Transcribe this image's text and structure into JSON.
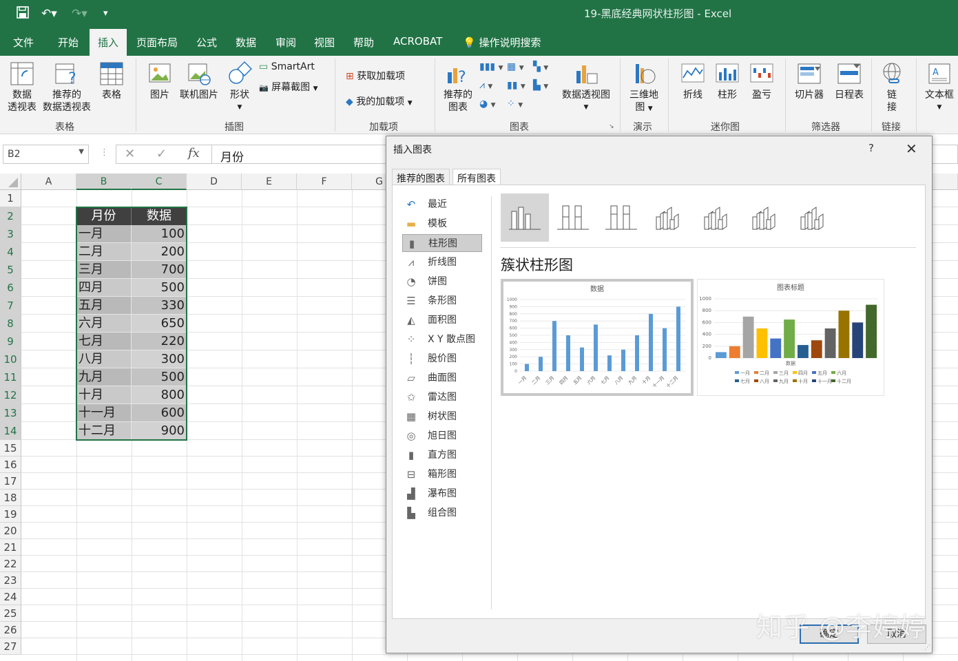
{
  "window": {
    "title": "19-黑底经典网状柱形图  -  Excel"
  },
  "menu": {
    "tabs": [
      "文件",
      "开始",
      "插入",
      "页面布局",
      "公式",
      "数据",
      "审阅",
      "视图",
      "帮助",
      "ACROBAT"
    ],
    "active": "插入",
    "tell_me": "操作说明搜索"
  },
  "ribbon": {
    "groups": {
      "tables": "表格",
      "illustrations": "插图",
      "addins": "加载项",
      "charts": "图表",
      "tours": "演示",
      "sparklines": "迷你图",
      "filters": "筛选器",
      "links": "链接"
    },
    "buttons": {
      "pivot_l1": "数据",
      "pivot_l2": "透视表",
      "rec_pivot_l1": "推荐的",
      "rec_pivot_l2": "数据透视表",
      "table": "表格",
      "picture": "图片",
      "online_picture": "联机图片",
      "shapes": "形状",
      "smartart": "SmartArt",
      "screenshot": "屏幕截图",
      "get_addins": "获取加载项",
      "my_addins": "我的加载项",
      "rec_charts_l1": "推荐的",
      "rec_charts_l2": "图表",
      "pivot_chart": "数据透视图",
      "map3d_l1": "三维地",
      "map3d_l2": "图",
      "line": "折线",
      "column": "柱形",
      "winloss": "盈亏",
      "slicer": "切片器",
      "timeline": "日程表",
      "link_l1": "链",
      "link_l2": "接",
      "textbox": "文本框"
    }
  },
  "formula_bar": {
    "name_box": "B2",
    "formula": "月份"
  },
  "sheet": {
    "columns": [
      "A",
      "B",
      "C",
      "D",
      "E",
      "F",
      "G"
    ],
    "rows": [
      "1",
      "2",
      "3",
      "4",
      "5",
      "6",
      "7",
      "8",
      "9",
      "10",
      "11",
      "12",
      "13",
      "14",
      "15",
      "16",
      "17",
      "18",
      "19",
      "20",
      "21",
      "22",
      "23",
      "24",
      "25",
      "26",
      "27"
    ],
    "table_headers": [
      "月份",
      "数据"
    ],
    "table_rows": [
      [
        "一月",
        "100"
      ],
      [
        "二月",
        "200"
      ],
      [
        "三月",
        "700"
      ],
      [
        "四月",
        "500"
      ],
      [
        "五月",
        "330"
      ],
      [
        "六月",
        "650"
      ],
      [
        "七月",
        "220"
      ],
      [
        "八月",
        "300"
      ],
      [
        "九月",
        "500"
      ],
      [
        "十月",
        "800"
      ],
      [
        "十一月",
        "600"
      ],
      [
        "十二月",
        "900"
      ]
    ]
  },
  "dialog": {
    "title": "插入图表",
    "help": "?",
    "tabs": [
      "推荐的图表",
      "所有图表"
    ],
    "active_tab": "所有图表",
    "chart_types": [
      "最近",
      "模板",
      "柱形图",
      "折线图",
      "饼图",
      "条形图",
      "面积图",
      "X Y 散点图",
      "股价图",
      "曲面图",
      "雷达图",
      "树状图",
      "旭日图",
      "直方图",
      "箱形图",
      "瀑布图",
      "组合图"
    ],
    "selected_type": "柱形图",
    "subtype_name": "簇状柱形图",
    "ok": "确定",
    "cancel": "取消"
  },
  "chart_data": [
    {
      "type": "bar",
      "title": "数据",
      "categories": [
        "一月",
        "二月",
        "三月",
        "四月",
        "五月",
        "六月",
        "七月",
        "八月",
        "九月",
        "十月",
        "十一月",
        "十二月"
      ],
      "values": [
        100,
        200,
        700,
        500,
        330,
        650,
        220,
        300,
        500,
        800,
        600,
        900
      ],
      "ylim": [
        0,
        1000
      ],
      "yticks": [
        0,
        100,
        200,
        300,
        400,
        500,
        600,
        700,
        800,
        900,
        1000
      ],
      "color": "#5b9bd5",
      "grid": true
    },
    {
      "type": "bar",
      "title": "图表标题",
      "xlabel": "数据",
      "categories": [
        "一月",
        "二月",
        "三月",
        "四月",
        "五月",
        "六月",
        "七月",
        "八月",
        "九月",
        "十月",
        "十一月",
        "十二月"
      ],
      "values": [
        100,
        200,
        700,
        500,
        330,
        650,
        220,
        300,
        500,
        800,
        600,
        900
      ],
      "ylim": [
        0,
        1000
      ],
      "yticks": [
        0,
        200,
        400,
        600,
        800,
        1000
      ],
      "colors": [
        "#5b9bd5",
        "#ed7d31",
        "#a5a5a5",
        "#ffc000",
        "#4472c4",
        "#70ad47",
        "#255e91",
        "#9e480e",
        "#636363",
        "#997300",
        "#264478",
        "#43682b"
      ],
      "grid": true,
      "legend": "bottom"
    }
  ],
  "watermark": "知乎 @李婷婷"
}
